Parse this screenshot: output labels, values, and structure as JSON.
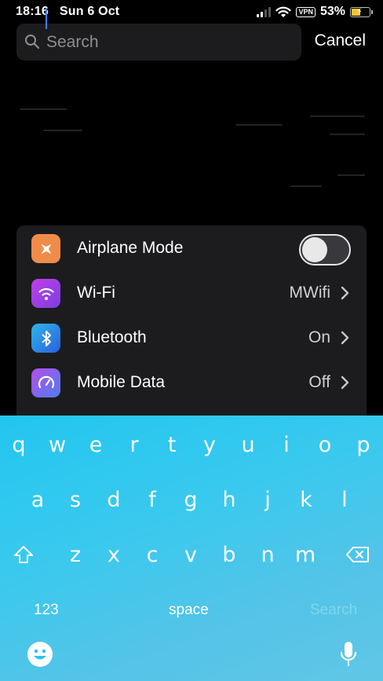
{
  "status_bar": {
    "time": "18:16",
    "date": "Sun 6 Oct",
    "vpn": "VPN",
    "battery_percent": "53%",
    "battery_level": 0.53,
    "battery_color": "#f2c530"
  },
  "search": {
    "placeholder": "Search",
    "value": "",
    "cancel_label": "Cancel",
    "icon": "magnifying-glass"
  },
  "settings": {
    "items": [
      {
        "label": "Airplane Mode",
        "icon": "airplane-icon",
        "icon_color": "#f08c4a",
        "control": "toggle",
        "toggle_on": false
      },
      {
        "label": "Wi-Fi",
        "value": "MWifi",
        "icon": "wifi-icon",
        "icon_color": "#9b3fe0",
        "control": "chevron"
      },
      {
        "label": "Bluetooth",
        "value": "On",
        "icon": "bluetooth-icon",
        "icon_color": "#2a7de1",
        "control": "chevron"
      },
      {
        "label": "Mobile Data",
        "value": "Off",
        "icon": "speedometer-icon",
        "icon_color": "#5b6df0",
        "control": "chevron"
      }
    ]
  },
  "keyboard": {
    "row1": [
      "q",
      "w",
      "e",
      "r",
      "t",
      "y",
      "u",
      "i",
      "o",
      "p"
    ],
    "row2": [
      "a",
      "s",
      "d",
      "f",
      "g",
      "h",
      "j",
      "k",
      "l"
    ],
    "row3": [
      "z",
      "x",
      "c",
      "v",
      "b",
      "n",
      "m"
    ],
    "numbers_label": "123",
    "space_label": "space",
    "return_label": "Search",
    "background_colors": [
      "#22c6f0",
      "#61c6e6"
    ]
  }
}
